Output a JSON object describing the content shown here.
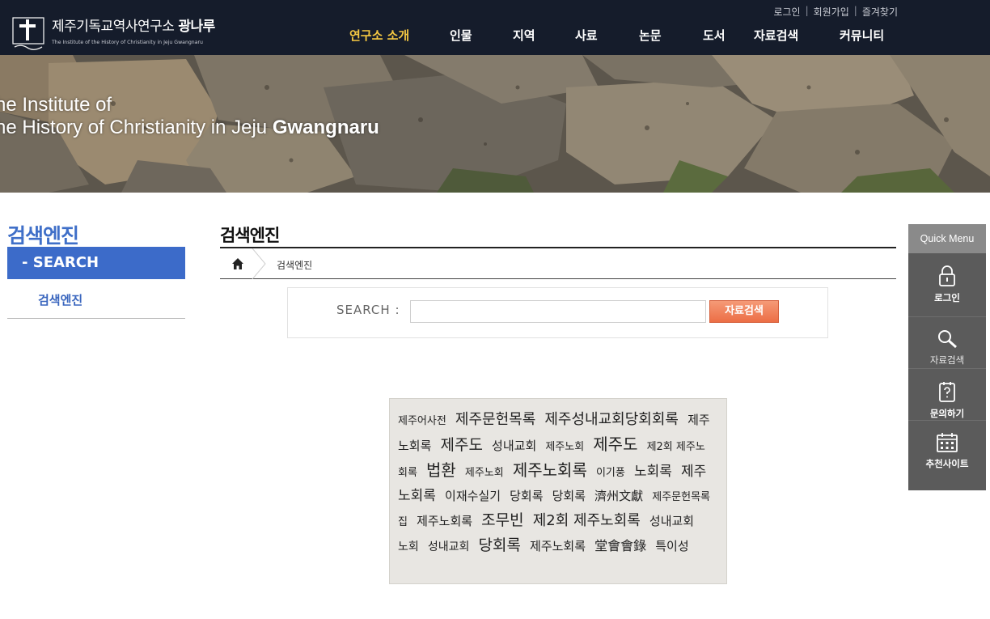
{
  "header": {
    "logo_title": "제주기독교역사연구소",
    "logo_title_bold": "광나루",
    "logo_sub": "The Institute of the History of Christianity in Jeju Gwangnaru",
    "util": [
      "로그인",
      "회원가입",
      "즐겨찾기"
    ],
    "nav": [
      "연구소 소개",
      "인물",
      "지역",
      "사료",
      "논문",
      "도서",
      "자료검색",
      "커뮤니티"
    ],
    "active_nav": "연구소 소개",
    "active_color": "#f5c842"
  },
  "banner": {
    "line1": "he Institute of",
    "line2_plain": "he History of Christianity in Jeju",
    "line2_bold": "Gwangnaru"
  },
  "lnb": {
    "title": "검색엔진",
    "section": "- SEARCH",
    "item": "검색엔진"
  },
  "content": {
    "page_title": "검색엔진",
    "breadcrumb": "검색엔진",
    "search_label": "SEARCH :",
    "search_value": "",
    "search_button": "자료검색"
  },
  "tag_cloud": [
    {
      "text": "제주어사전",
      "size": 13
    },
    {
      "text": "제주문헌목록",
      "size": 18
    },
    {
      "text": "제주성내교회당회회록",
      "size": 18
    },
    {
      "text": "제주노회록",
      "size": 15
    },
    {
      "text": "제주도",
      "size": 19
    },
    {
      "text": "성내교회",
      "size": 15
    },
    {
      "text": "제주노회",
      "size": 13
    },
    {
      "text": "제주도",
      "size": 20
    },
    {
      "text": "제2회 제주노회록",
      "size": 13
    },
    {
      "text": "법환",
      "size": 20
    },
    {
      "text": "제주노회",
      "size": 13
    },
    {
      "text": "제주노회록",
      "size": 20
    },
    {
      "text": "이기풍",
      "size": 13
    },
    {
      "text": "노회록",
      "size": 17
    },
    {
      "text": "제주노회록",
      "size": 17
    },
    {
      "text": "이재수실기",
      "size": 15
    },
    {
      "text": "당회록",
      "size": 15
    },
    {
      "text": "당회록",
      "size": 15
    },
    {
      "text": "濟州文獻",
      "size": 15
    },
    {
      "text": "제주문헌목록집",
      "size": 13
    },
    {
      "text": "제주노회록",
      "size": 15
    },
    {
      "text": "조무빈",
      "size": 19
    },
    {
      "text": "제2회 제주노회록",
      "size": 18
    },
    {
      "text": "성내교회",
      "size": 15
    },
    {
      "text": "노회",
      "size": 14
    },
    {
      "text": "성내교회",
      "size": 14
    },
    {
      "text": "당회록",
      "size": 19
    },
    {
      "text": "제주노회록",
      "size": 15
    },
    {
      "text": "堂會會錄",
      "size": 16
    },
    {
      "text": "특이성",
      "size": 15
    }
  ],
  "quick": {
    "title": "Quick Menu",
    "items": [
      {
        "label": "로그인",
        "icon": "lock-icon"
      },
      {
        "label": "자료검색",
        "icon": "search-icon"
      },
      {
        "label": "문의하기",
        "icon": "question-note-icon"
      },
      {
        "label": "추천사이트",
        "icon": "calendar-icon"
      }
    ]
  }
}
